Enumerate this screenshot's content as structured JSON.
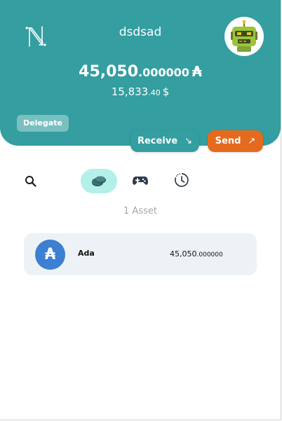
{
  "header": {
    "wallet_name": "dsdsad",
    "balance": {
      "ada_integer": "45,050",
      "ada_decimal": ".000000",
      "ada_symbol": "₳",
      "usd_integer": "15,833",
      "usd_decimal": ".40",
      "usd_symbol": "$"
    },
    "delegate_label": "Delegate",
    "receive_label": "Receive",
    "receive_arrow": "↘",
    "send_label": "Send",
    "send_arrow": "↗"
  },
  "tabs": {
    "active": "assets",
    "items": [
      "search-icon",
      "assets-icon",
      "collectibles-icon",
      "history-icon"
    ]
  },
  "assets": {
    "count_label": "1 Asset",
    "items": [
      {
        "icon_symbol": "₳",
        "name": "Ada",
        "amount_integer": "45,050",
        "amount_decimal": ".000000"
      }
    ]
  },
  "colors": {
    "header": "#349ea0",
    "send": "#e46a1e",
    "active_tab": "#b2f0e9",
    "ada_icon": "#3d7fd1",
    "asset_row": "#edf2f6"
  }
}
